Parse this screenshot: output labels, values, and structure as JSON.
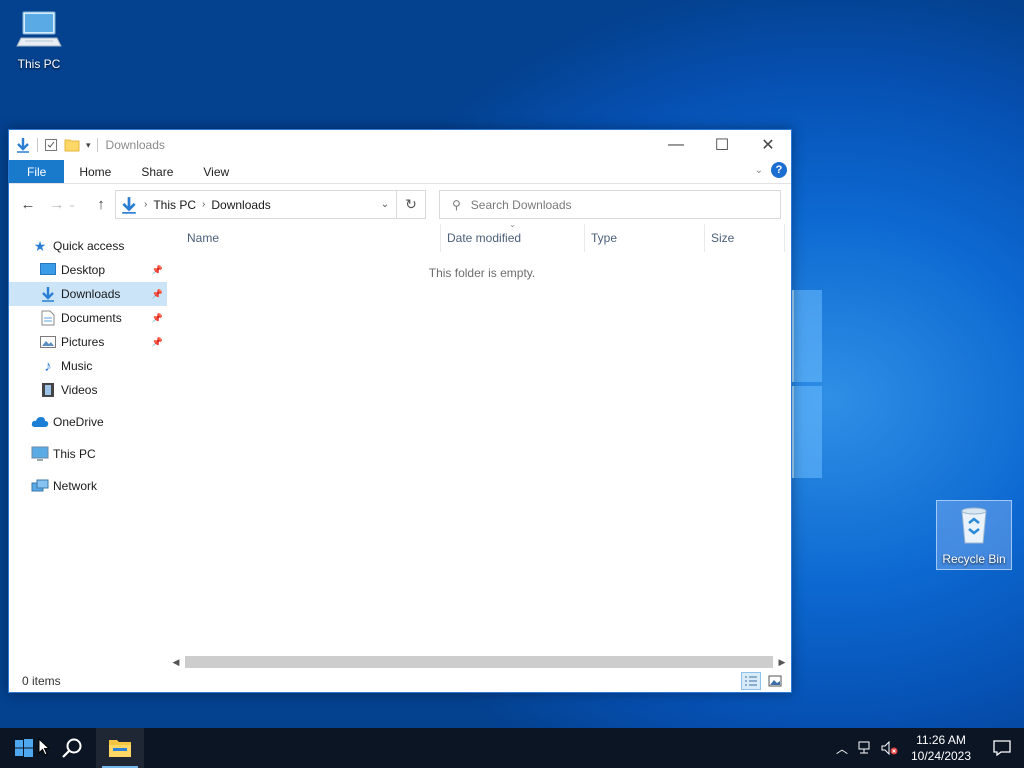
{
  "desktop": {
    "icons": [
      {
        "label": "This PC"
      },
      {
        "label": "Recycle Bin"
      }
    ]
  },
  "window": {
    "title": "Downloads",
    "ribbon_tabs": [
      "File",
      "Home",
      "Share",
      "View"
    ],
    "address": {
      "crumbs": [
        "This PC",
        "Downloads"
      ]
    },
    "search": {
      "placeholder": "Search Downloads"
    },
    "nav": {
      "quick_access": "Quick access",
      "items": [
        {
          "label": "Desktop",
          "icon": "desktop-icon",
          "pinned": true
        },
        {
          "label": "Downloads",
          "icon": "download-icon",
          "pinned": true,
          "selected": true
        },
        {
          "label": "Documents",
          "icon": "documents-icon",
          "pinned": true
        },
        {
          "label": "Pictures",
          "icon": "pictures-icon",
          "pinned": true
        },
        {
          "label": "Music",
          "icon": "music-icon",
          "pinned": false
        },
        {
          "label": "Videos",
          "icon": "videos-icon",
          "pinned": false
        }
      ],
      "onedrive": "OneDrive",
      "this_pc": "This PC",
      "network": "Network"
    },
    "columns": [
      "Name",
      "Date modified",
      "Type",
      "Size"
    ],
    "empty_message": "This folder is empty.",
    "status": "0 items"
  },
  "taskbar": {
    "time": "11:26 AM",
    "date": "10/24/2023"
  },
  "colors": {
    "accent": "#1979ca",
    "selection": "#cce4f7",
    "taskbar": "#0c1524"
  }
}
